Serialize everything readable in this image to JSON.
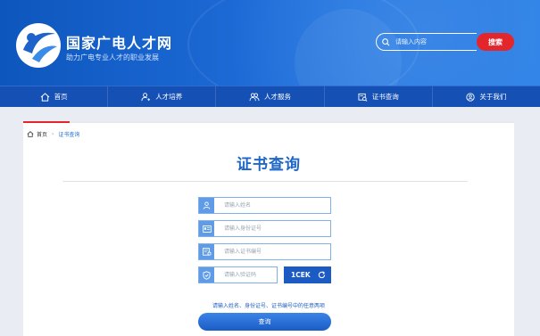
{
  "header": {
    "site_title": "国家广电人才网",
    "site_subtitle": "助力广电专业人才的职业发展",
    "search_placeholder": "请输入内容",
    "search_button": "搜索"
  },
  "nav": {
    "items": [
      {
        "label": "首页",
        "icon": "home-icon"
      },
      {
        "label": "人才培养",
        "icon": "person-add-icon"
      },
      {
        "label": "人才服务",
        "icon": "people-icon"
      },
      {
        "label": "证书查询",
        "icon": "certificate-search-icon"
      },
      {
        "label": "关于我们",
        "icon": "about-icon"
      }
    ]
  },
  "breadcrumb": {
    "home": "首页",
    "separator": "›",
    "current": "证书查询"
  },
  "main": {
    "title": "证书查询",
    "name_placeholder": "请输入姓名",
    "idcard_placeholder": "请输入身份证号",
    "cert_placeholder": "请输入证书编号",
    "captcha_placeholder": "请输入验证码",
    "captcha_code": "1CEK",
    "hint": "请输入姓名、身份证号、证书编号中的任意两项",
    "query_button": "查询"
  },
  "colors": {
    "primary_blue": "#1e67c9",
    "nav_blue": "#1550b4",
    "search_red": "#e3262c",
    "field_icon_blue": "#5f9be6"
  }
}
